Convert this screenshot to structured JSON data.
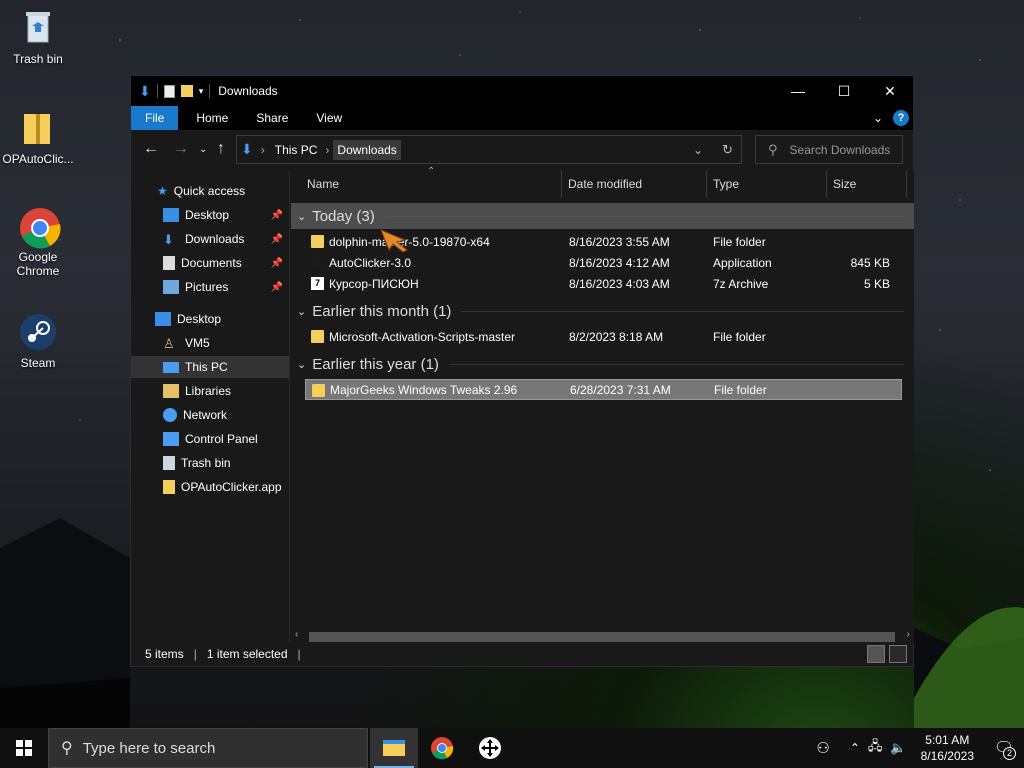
{
  "desktop_icons": [
    {
      "label": "Trash bin",
      "icon": "recycle-bin-icon"
    },
    {
      "label": "OPAutoClic...",
      "icon": "folder-zip-icon"
    },
    {
      "label": "Google Chrome",
      "icon": "chrome-icon"
    },
    {
      "label": "Steam",
      "icon": "steam-icon"
    }
  ],
  "window": {
    "title": "Downloads",
    "ribbon_tabs": [
      "File",
      "Home",
      "Share",
      "View"
    ],
    "address": {
      "crumbs": [
        "This PC",
        "Downloads"
      ]
    },
    "search_placeholder": "Search Downloads",
    "nav": {
      "quick_access": "Quick access",
      "quick_items": [
        "Desktop",
        "Downloads",
        "Documents",
        "Pictures"
      ],
      "tree_items": [
        "Desktop",
        "VM5",
        "This PC",
        "Libraries",
        "Network",
        "Control Panel",
        "Trash bin",
        "OPAutoClicker.app"
      ]
    },
    "columns": {
      "name": "Name",
      "date": "Date modified",
      "type": "Type",
      "size": "Size"
    },
    "groups": [
      {
        "label": "Today (3)",
        "rows": [
          {
            "name": "dolphin-master-5.0-19870-x64",
            "date": "8/16/2023 3:55 AM",
            "type": "File folder",
            "size": ""
          },
          {
            "name": "AutoClicker-3.0",
            "date": "8/16/2023 4:12 AM",
            "type": "Application",
            "size": "845 KB"
          },
          {
            "name": "Курсор-ПИСЮН",
            "date": "8/16/2023 4:03 AM",
            "type": "7z Archive",
            "size": "5 KB"
          }
        ]
      },
      {
        "label": "Earlier this month (1)",
        "rows": [
          {
            "name": "Microsoft-Activation-Scripts-master",
            "date": "8/2/2023 8:18 AM",
            "type": "File folder",
            "size": ""
          }
        ]
      },
      {
        "label": "Earlier this year (1)",
        "rows": [
          {
            "name": "MajorGeeks Windows Tweaks 2.96",
            "date": "6/28/2023 7:31 AM",
            "type": "File folder",
            "size": ""
          }
        ]
      }
    ],
    "status": {
      "items": "5 items",
      "selected": "1 item selected"
    }
  },
  "taskbar": {
    "search_placeholder": "Type here to search",
    "time": "5:01 AM",
    "date": "8/16/2023",
    "notifications": "2"
  },
  "colors": {
    "accent": "#1979ca",
    "folder": "#f4cf5b",
    "selection": "#777777"
  }
}
